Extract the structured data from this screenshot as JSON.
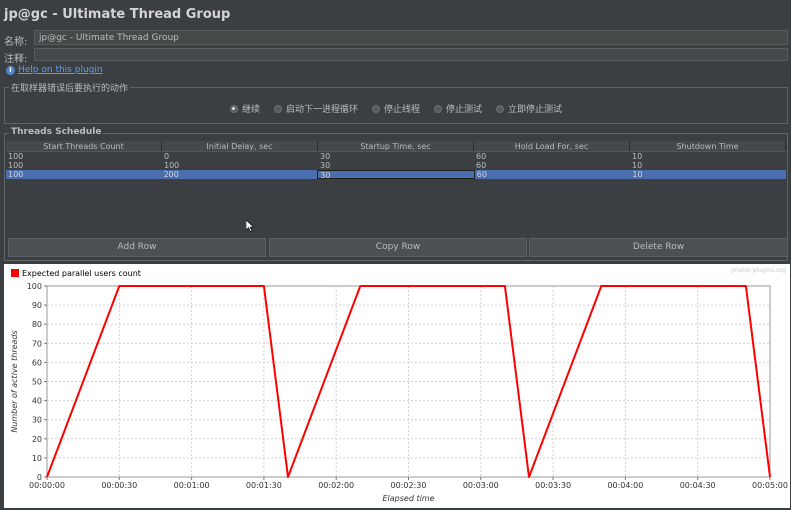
{
  "window": {
    "title": "jp@gc - Ultimate Thread Group"
  },
  "form": {
    "name_label": "名称:",
    "name_value": "jp@gc - Ultimate Thread Group",
    "comment_label": "注释:",
    "help_link": "Help on this plugin"
  },
  "sampler_error": {
    "legend": "在取样器错误后要执行的动作",
    "options": [
      "继续",
      "启动下一进程循环",
      "停止线程",
      "停止测试",
      "立即停止测试"
    ],
    "selected": 0
  },
  "schedule": {
    "legend": "Threads Schedule",
    "columns": [
      "Start Threads Count",
      "Initial Delay, sec",
      "Startup Time, sec",
      "Hold Load For, sec",
      "Shutdown Time"
    ],
    "rows": [
      [
        "100",
        "0",
        "30",
        "60",
        "10"
      ],
      [
        "100",
        "100",
        "30",
        "60",
        "10"
      ],
      [
        "100",
        "200",
        "30",
        "60",
        "10"
      ]
    ],
    "selected_row": 2
  },
  "buttons": {
    "add_row": "Add Row",
    "copy_row": "Copy Row",
    "delete_row": "Delete Row"
  },
  "colors": {
    "series": "#ff0000",
    "selection": "#4b6eaf",
    "background": "#3c3f41"
  },
  "chart_data": {
    "type": "line",
    "watermark": "jmeter-plugins.org",
    "xlabel": "Elapsed time",
    "ylabel": "Number of active threads",
    "xlim": [
      0,
      300
    ],
    "ylim": [
      0,
      100
    ],
    "x_ticks": [
      "00:00:00",
      "00:00:30",
      "00:01:00",
      "00:01:30",
      "00:02:00",
      "00:02:30",
      "00:03:00",
      "00:03:30",
      "00:04:00",
      "00:04:30",
      "00:05:00"
    ],
    "y_ticks": [
      "0",
      "10",
      "20",
      "30",
      "40",
      "50",
      "60",
      "70",
      "80",
      "90",
      "100"
    ],
    "grid": true,
    "legend": "top-left",
    "series": [
      {
        "name": "Expected parallel users count",
        "x": [
          0,
          30,
          90,
          100,
          130,
          190,
          200,
          230,
          290,
          300
        ],
        "y": [
          0,
          100,
          100,
          0,
          100,
          100,
          0,
          100,
          100,
          0
        ]
      }
    ]
  }
}
